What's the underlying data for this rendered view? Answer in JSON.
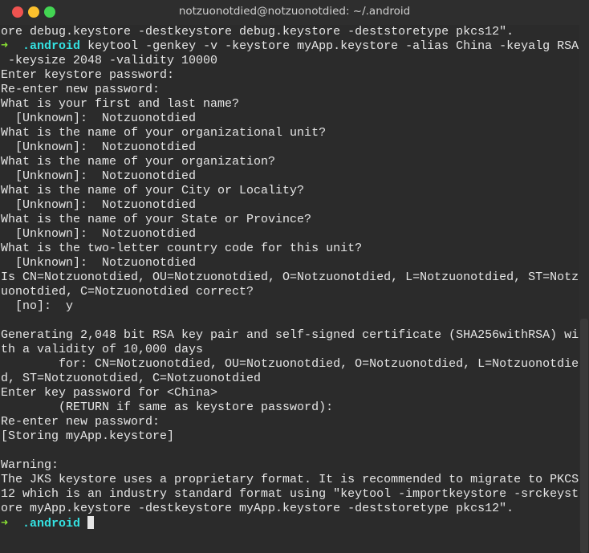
{
  "window": {
    "title": "notzuonotdied@notzuonotdied: ~/.android",
    "buttons": {
      "close_color": "#ef5350",
      "minimize_color": "#fbc02d",
      "maximize_color": "#43d553"
    }
  },
  "colors": {
    "background": "#2b2b2b",
    "text": "#e6e6e6",
    "prompt_arrow": "#8ae234",
    "prompt_dir": "#34e2e2"
  },
  "prompt": {
    "arrow": "➜",
    "dir": ".android"
  },
  "lines": [
    {
      "text": "ore debug.keystore -destkeystore debug.keystore -deststoretype pkcs12\"."
    },
    {
      "prompt": true,
      "text": " keytool -genkey -v -keystore myApp.keystore -alias China -keyalg RSA"
    },
    {
      "text": " -keysize 2048 -validity 10000"
    },
    {
      "text": "Enter keystore password:"
    },
    {
      "text": "Re-enter new password:"
    },
    {
      "text": "What is your first and last name?"
    },
    {
      "text": "  [Unknown]:  Notzuonotdied"
    },
    {
      "text": "What is the name of your organizational unit?"
    },
    {
      "text": "  [Unknown]:  Notzuonotdied"
    },
    {
      "text": "What is the name of your organization?"
    },
    {
      "text": "  [Unknown]:  Notzuonotdied"
    },
    {
      "text": "What is the name of your City or Locality?"
    },
    {
      "text": "  [Unknown]:  Notzuonotdied"
    },
    {
      "text": "What is the name of your State or Province?"
    },
    {
      "text": "  [Unknown]:  Notzuonotdied"
    },
    {
      "text": "What is the two-letter country code for this unit?"
    },
    {
      "text": "  [Unknown]:  Notzuonotdied"
    },
    {
      "text": "Is CN=Notzuonotdied, OU=Notzuonotdied, O=Notzuonotdied, L=Notzuonotdied, ST=Notz"
    },
    {
      "text": "uonotdied, C=Notzuonotdied correct?"
    },
    {
      "text": "  [no]:  y"
    },
    {
      "text": ""
    },
    {
      "text": "Generating 2,048 bit RSA key pair and self-signed certificate (SHA256withRSA) wi"
    },
    {
      "text": "th a validity of 10,000 days"
    },
    {
      "text": "        for: CN=Notzuonotdied, OU=Notzuonotdied, O=Notzuonotdied, L=Notzuonotdie"
    },
    {
      "text": "d, ST=Notzuonotdied, C=Notzuonotdied"
    },
    {
      "text": "Enter key password for <China>"
    },
    {
      "text": "        (RETURN if same as keystore password):"
    },
    {
      "text": "Re-enter new password:"
    },
    {
      "text": "[Storing myApp.keystore]"
    },
    {
      "text": ""
    },
    {
      "text": "Warning:"
    },
    {
      "text": "The JKS keystore uses a proprietary format. It is recommended to migrate to PKCS"
    },
    {
      "text": "12 which is an industry standard format using \"keytool -importkeystore -srckeyst"
    },
    {
      "text": "ore myApp.keystore -destkeystore myApp.keystore -deststoretype pkcs12\"."
    },
    {
      "prompt": true,
      "cursor": true,
      "text": ""
    }
  ]
}
